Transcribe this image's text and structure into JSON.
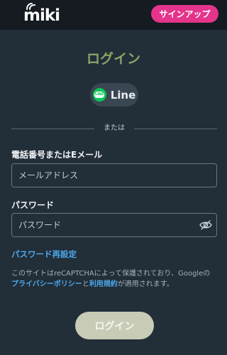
{
  "header": {
    "logo_text": "miki",
    "signup_label": "サインアップ"
  },
  "login": {
    "title": "ログイン",
    "line_label": "Line",
    "line_icon_text": "LINE",
    "divider_text": "または",
    "identifier_label": "電話番号またはEメール",
    "identifier_placeholder": "メールアドレス",
    "password_label": "パスワード",
    "password_placeholder": "パスワード",
    "reset_link": "パスワード再設定",
    "recaptcha_prefix": "このサイトはreCAPTCHAによって保護されており、Googleの",
    "privacy_link": "プライバシーポリシー",
    "recaptcha_and": "と",
    "terms_link": "利用規約",
    "recaptcha_suffix": "が適用されます。",
    "submit_label": "ログイン"
  },
  "colors": {
    "background": "#222e38",
    "topbar": "#151b21",
    "signup_accent": "#e4348b",
    "title": "#8fa267",
    "link": "#4ca8ec",
    "line_green": "#06c755",
    "submit_disabled": "#c8ccb6"
  }
}
